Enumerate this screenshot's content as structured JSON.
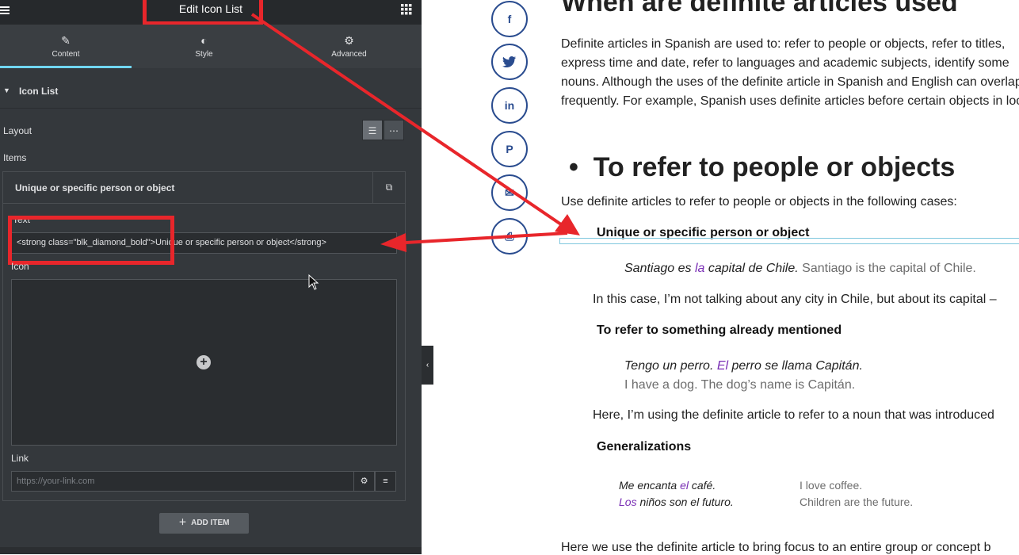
{
  "panel": {
    "title": "Edit Icon List",
    "tabs": [
      {
        "label": "Content",
        "icon": "pencil-icon"
      },
      {
        "label": "Style",
        "icon": "half-circle-icon"
      },
      {
        "label": "Advanced",
        "icon": "gear-icon"
      }
    ],
    "section_title": "Icon List",
    "layout_label": "Layout",
    "items_label": "Items",
    "item_title": "Unique or specific person or object",
    "text_label": "Text",
    "text_value": "<strong class=\"blk_diamond_bold\">Unique or specific person or object</strong>",
    "icon_label": "Icon",
    "link_label": "Link",
    "link_placeholder": "https://your-link.com",
    "add_item_label": "ADD ITEM"
  },
  "share_icons": [
    "facebook-icon",
    "twitter-icon",
    "linkedin-icon",
    "pinterest-icon",
    "email-icon",
    "print-icon"
  ],
  "article": {
    "heading": "When are definite articles used",
    "intro": "Definite articles in Spanish are used to: refer to people or objects, refer to titles, express time and date, refer to languages and academic subjects, identify some nouns. Although the uses of the definite article in Spanish and English can overlap frequently. For example, Spanish uses definite articles before certain objects in look!",
    "subheading": "To refer to people or objects",
    "lead": "Use definite articles to refer to people or objects in the following cases:",
    "list1": "Unique or specific person or object",
    "ex1_es_a": "Santiago es ",
    "ex1_art": "la",
    "ex1_es_b": " capital de Chile.",
    "ex1_en": "Santiago is the capital of Chile.",
    "para1": "In this case, I’m not talking about any city in Chile, but about its capital –",
    "list2": "To refer to something already mentioned",
    "ex2_es_a": "Tengo un perro. ",
    "ex2_art": "El",
    "ex2_es_b": " perro se llama Capitán.",
    "ex2_en": "I have a dog. The dog’s name is Capitán.",
    "para2": "Here, I’m using the definite article to refer to a noun that was introduced",
    "list3": "Generalizations",
    "ex3_es_a": "Me encanta ",
    "ex3_art": "el",
    "ex3_es_b": " café.",
    "ex3_en": "I love coffee.",
    "ex4_art": "Los",
    "ex4_es_b": " niños son el futuro.",
    "ex4_en": "Children are the future.",
    "para3": "Here we use the definite article to bring focus to an entire group or concept b"
  },
  "colors": {
    "panel_bg": "#34383c",
    "accent_tab": "#71d7f7",
    "highlight_red": "#e8262b",
    "article_purple": "#7a2fb5",
    "share_blue": "#2a4c8f"
  }
}
